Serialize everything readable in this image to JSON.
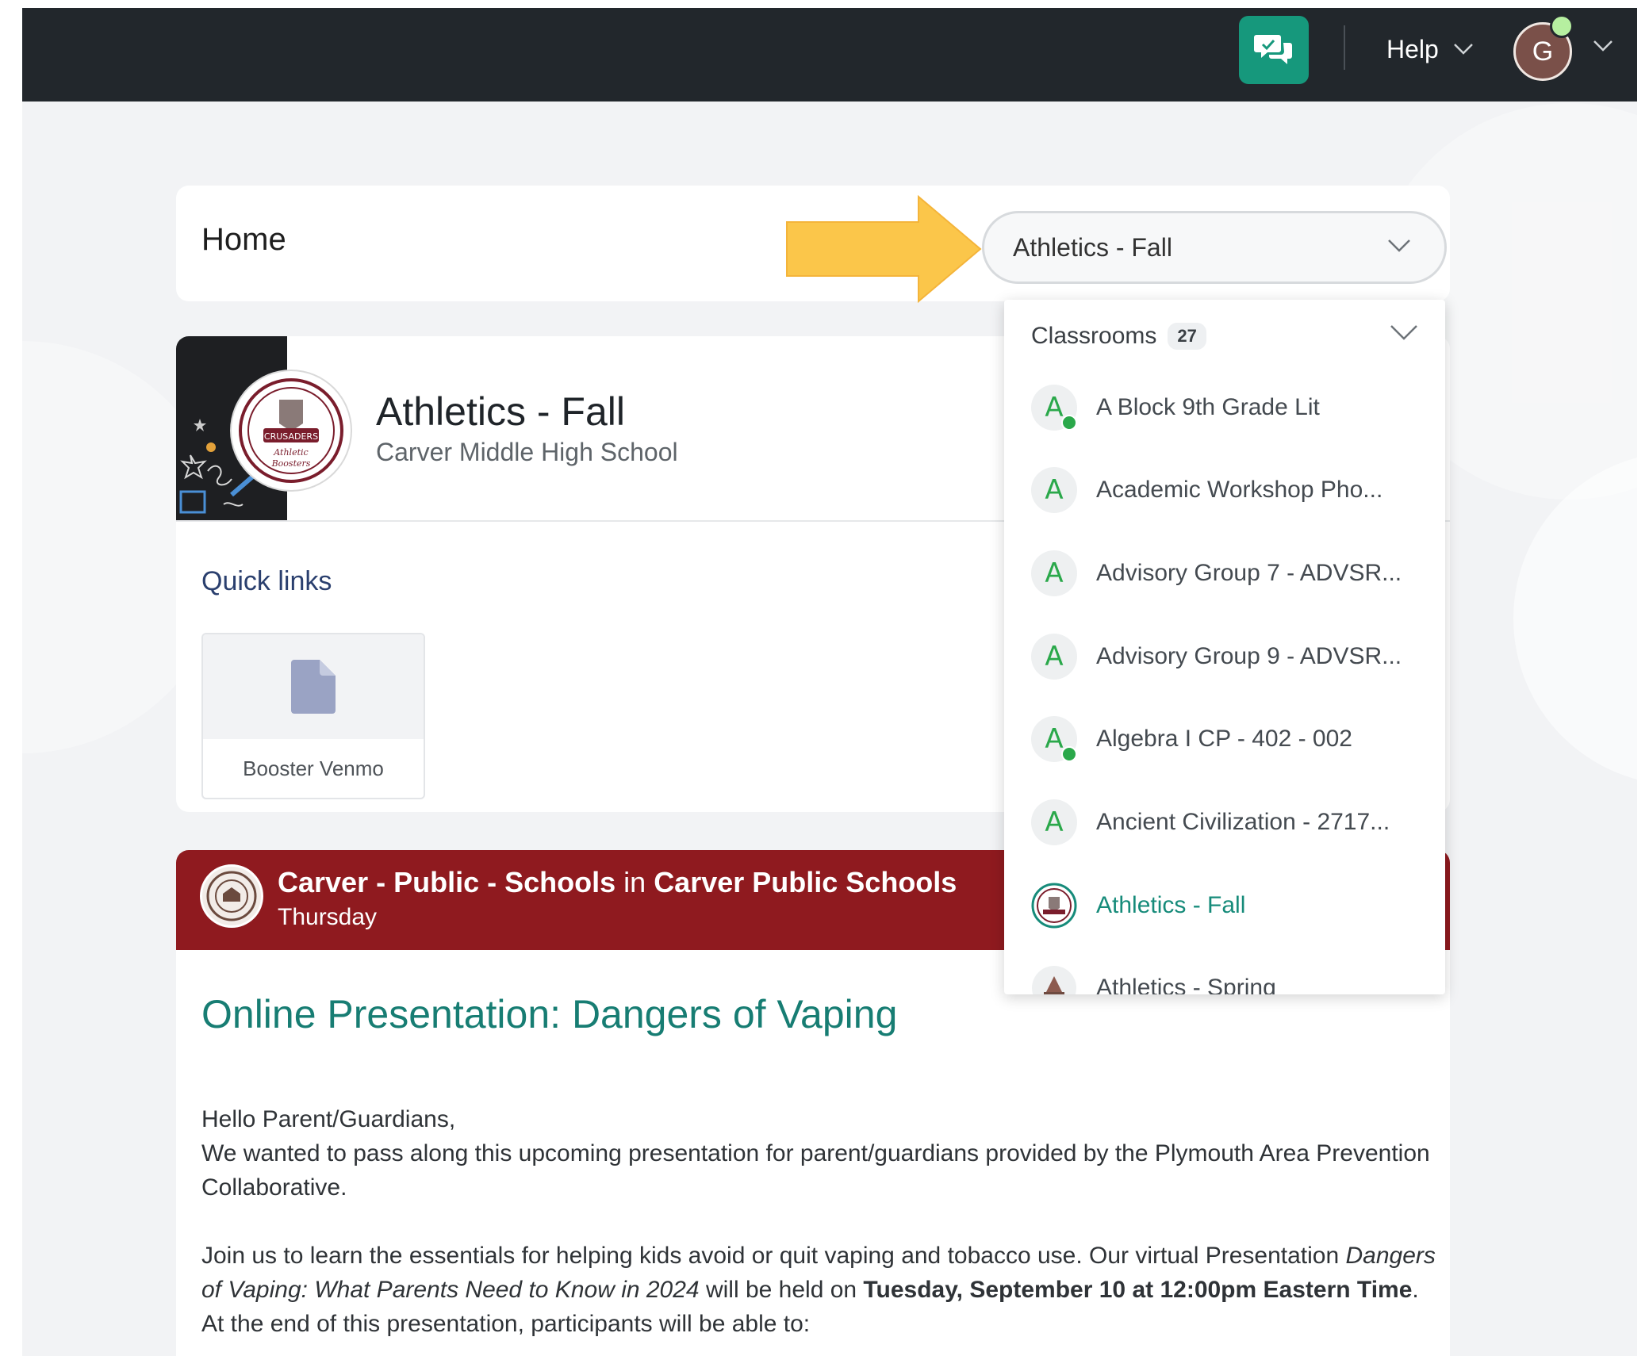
{
  "topbar": {
    "help_label": "Help",
    "avatar_initial": "G"
  },
  "home": {
    "title": "Home",
    "selected_class": "Athletics - Fall"
  },
  "classroom": {
    "title": "Athletics - Fall",
    "school": "Carver Middle High School",
    "quick_links_title": "Quick links",
    "quick_links": [
      {
        "label": "Booster Venmo"
      }
    ]
  },
  "dropdown": {
    "header_label": "Classrooms",
    "count": "27",
    "items": [
      {
        "badge": "A",
        "label": "A Block 9th Grade Lit"
      },
      {
        "badge": "A",
        "label": "Academic Workshop Pho..."
      },
      {
        "badge": "A",
        "label": "Advisory Group 7 - ADVSR..."
      },
      {
        "badge": "A",
        "label": "Advisory Group 9 - ADVSR..."
      },
      {
        "badge": "A",
        "label": "Algebra I CP - 402 - 002"
      },
      {
        "badge": "A",
        "label": "Ancient Civilization - 2717..."
      },
      {
        "badge": "",
        "label": "Athletics - Fall"
      },
      {
        "badge": "",
        "label": "Athletics - Spring"
      }
    ]
  },
  "post": {
    "org": "Carver - Public - Schools",
    "org_in": "in",
    "org_district": "Carver Public Schools",
    "day": "Thursday",
    "title": "Online Presentation: Dangers of Vaping",
    "greeting": "Hello Parent/Guardians,",
    "para1": "We wanted to pass along this upcoming presentation for parent/guardians provided by the Plymouth Area Prevention Collaborative.",
    "para2_a": "Join us to learn the essentials for helping kids avoid or quit vaping and tobacco use. Our virtual Presentation ",
    "para2_em": "Dangers of Vaping: What Parents Need to Know in 2024",
    "para2_b": " will be held on ",
    "para2_strong": "Tuesday, September 10 at 12:00pm Eastern Time",
    "para2_c": ". At the end of this presentation, participants will be able to:"
  },
  "colors": {
    "topbar": "#22272c",
    "chat_button": "#16987c",
    "post_header": "#8f1a1f",
    "post_title": "#177d73",
    "badge_green": "#2aa84a",
    "active_item": "#168b7a",
    "arrow": "#fbc64a"
  }
}
